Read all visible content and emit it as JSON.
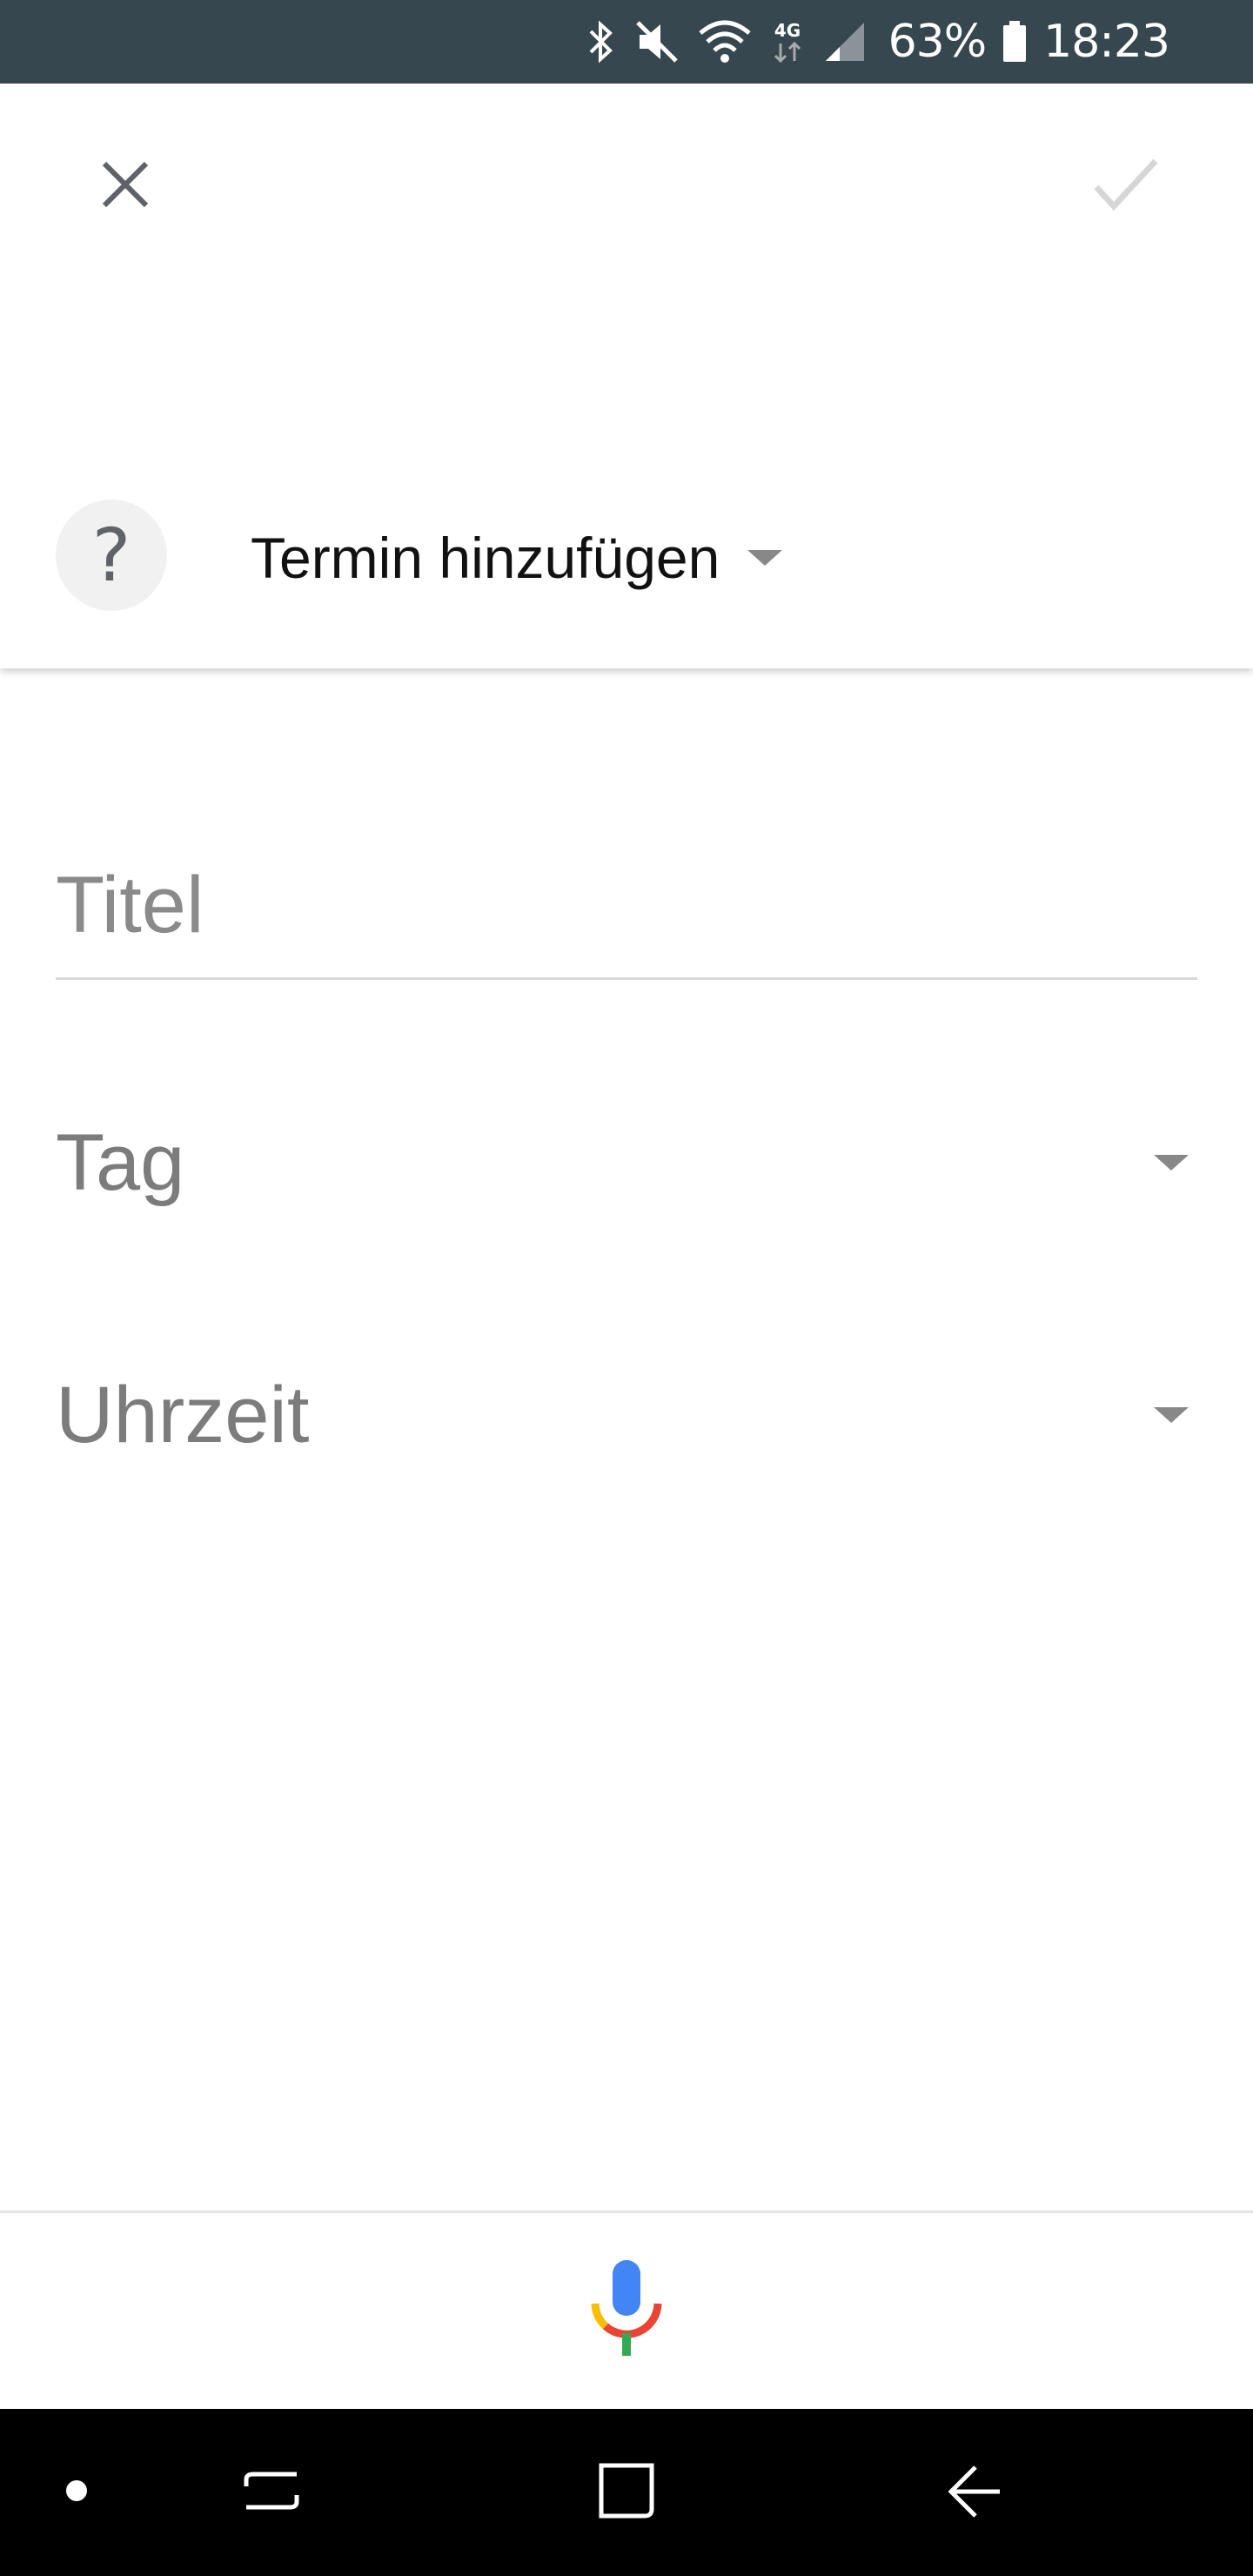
{
  "status_bar": {
    "battery_level": "63%",
    "time": "18:23",
    "network_type": "4G",
    "icons": [
      "bluetooth-icon",
      "mute-icon",
      "wifi-icon",
      "network-4g-icon",
      "signal-icon",
      "battery-icon"
    ]
  },
  "header": {
    "close_icon": "close-icon",
    "confirm_icon": "check-icon",
    "help_label": "?",
    "type_selector_label": "Termin hinzufügen"
  },
  "form": {
    "title_placeholder": "Titel",
    "title_value": "",
    "day_label": "Tag",
    "time_label": "Uhrzeit"
  },
  "bottom_bar": {
    "mic_icon": "microphone-icon"
  },
  "nav_bar": {
    "icons": [
      "dot-icon",
      "recent-apps-icon",
      "home-icon",
      "back-icon"
    ]
  },
  "colors": {
    "status_bar_bg": "#37474f",
    "mic_blue": "#4285f4",
    "mic_red": "#ea4335",
    "mic_yellow": "#fbbc05",
    "mic_green": "#34a853"
  }
}
